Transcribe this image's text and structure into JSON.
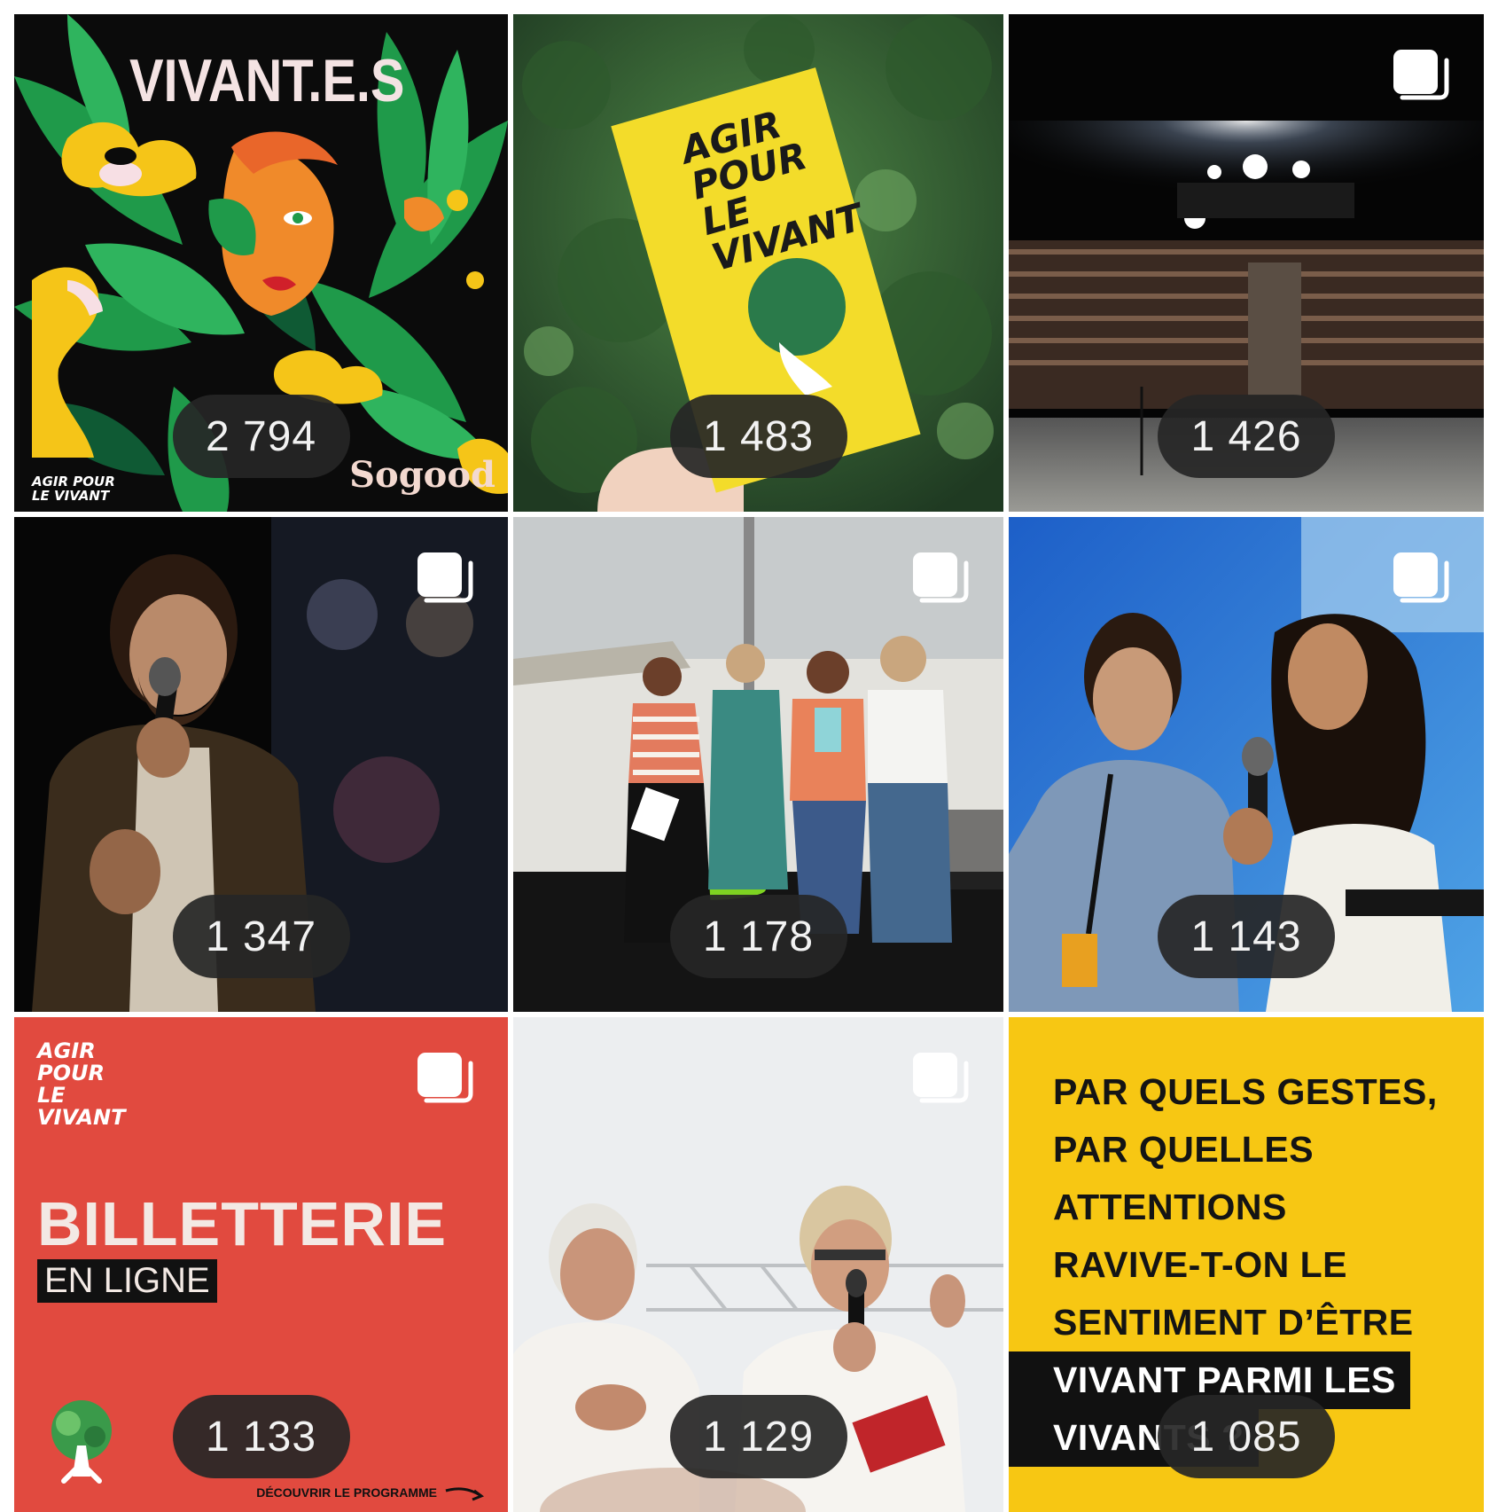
{
  "grid": {
    "posts": [
      {
        "count": "2 794",
        "multi": false,
        "caption_title": "VIVANT.E.S",
        "caption_brand": "Sogood",
        "logo": "AGIR POUR LE VIVANT"
      },
      {
        "count": "1 483",
        "multi": false,
        "caption_title": "AGIR POUR LE VIVANT"
      },
      {
        "count": "1 426",
        "multi": true
      },
      {
        "count": "1 347",
        "multi": true
      },
      {
        "count": "1 178",
        "multi": true
      },
      {
        "count": "1 143",
        "multi": true
      },
      {
        "count": "1 133",
        "multi": true,
        "logo": "AGIR POUR LE VIVANT",
        "title": "BILLETTERIE",
        "subtitle": "EN LIGNE",
        "cta": "DÉCOUVRIR LE PROGRAMME"
      },
      {
        "count": "1 129",
        "multi": true
      },
      {
        "count": "1 085",
        "multi": false,
        "quote_lines": [
          "PAR QUELS GESTES,",
          "PAR QUELLES",
          "ATTENTIONS",
          "RAVIVE-T-ON LE",
          "SENTIMENT D’ÊTRE",
          "VIVANT PARMI LES",
          "VIVANTS ?"
        ]
      }
    ]
  },
  "icons": {
    "multi": "carousel-icon"
  },
  "colors": {
    "pill_bg": "#262626",
    "billet_red": "#e14a3f",
    "quote_yellow": "#f7c713",
    "poster_black": "#0a0a0a"
  }
}
